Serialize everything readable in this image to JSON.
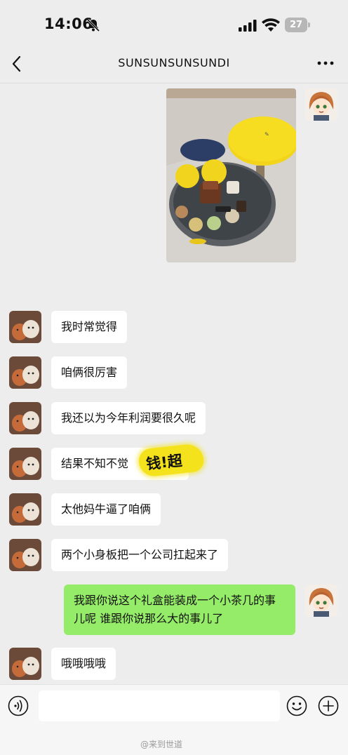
{
  "status": {
    "time": "14:06",
    "battery": "27"
  },
  "nav": {
    "title": "SUNSUNSUNSUNDI"
  },
  "messages": [
    {
      "from": "me",
      "type": "image"
    },
    {
      "from": "them",
      "text": "我时常觉得"
    },
    {
      "from": "them",
      "text": "咱俩很厉害"
    },
    {
      "from": "them",
      "text": "我还以为今年利润要很久呢"
    },
    {
      "from": "them",
      "text": "结果不知不觉"
    },
    {
      "from": "them",
      "text": "太他妈牛逼了咱俩"
    },
    {
      "from": "them",
      "text": "两个小身板把一个公司扛起来了"
    },
    {
      "from": "me",
      "text": "我跟你说这个礼盒能装成一个小茶几的事儿呢 谁跟你说那么大的事儿了"
    },
    {
      "from": "them",
      "text": "哦哦哦哦"
    }
  ],
  "sticker": {
    "text": "钱!超"
  },
  "watermark": "@来到世道",
  "colors": {
    "background": "#ededed",
    "my_bubble": "#95ec69",
    "their_bubble": "#ffffff",
    "sticker": "#f4e21c"
  },
  "icons": [
    "bell-slash-icon",
    "signal-icon",
    "wifi-icon",
    "battery-icon",
    "back-icon",
    "more-icon",
    "voice-icon",
    "emoji-icon",
    "plus-icon"
  ]
}
